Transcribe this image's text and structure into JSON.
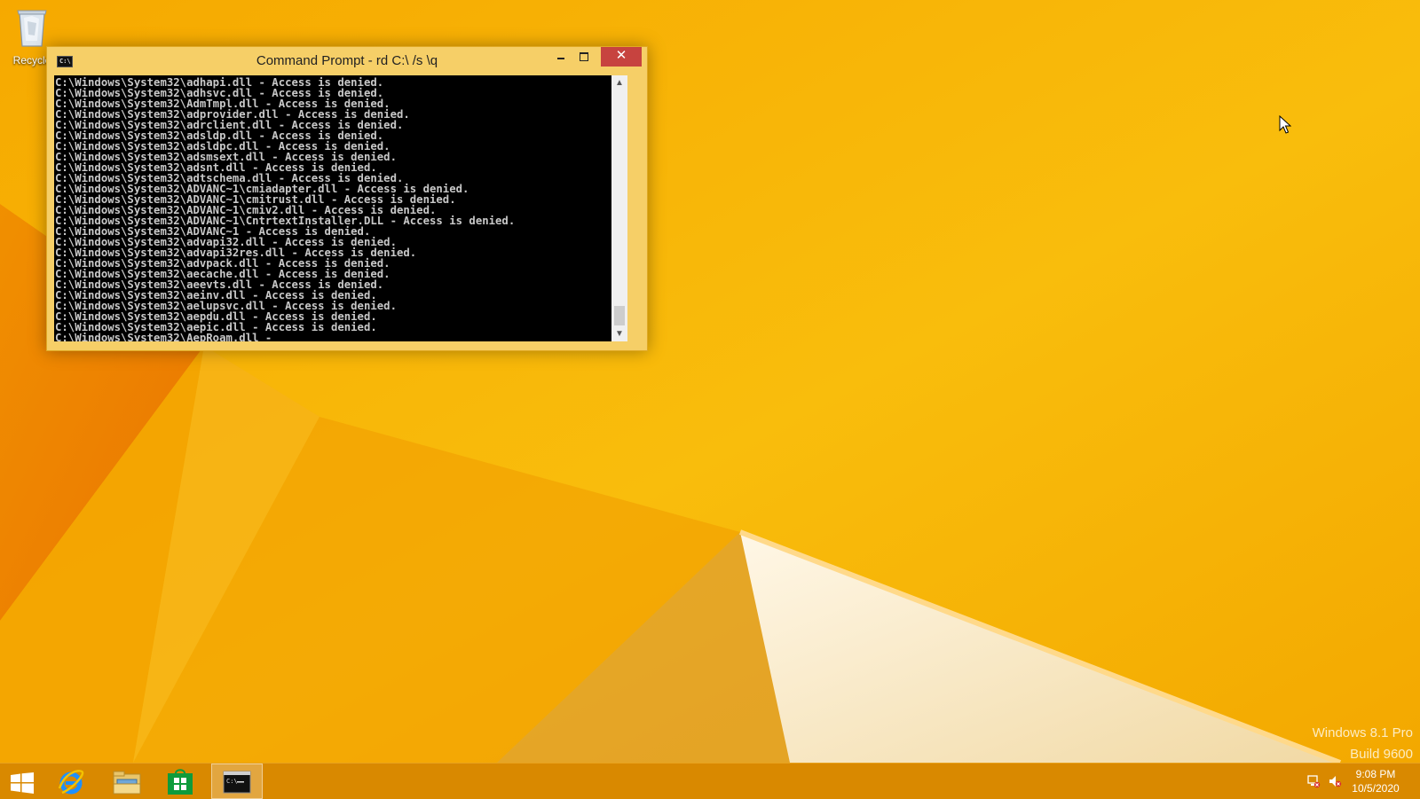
{
  "desktop": {
    "icons": [
      {
        "label": "Recycle",
        "icon": "recycle-bin-icon"
      }
    ],
    "watermark": {
      "edition": "Windows 8.1 Pro",
      "build": "Build 9600"
    },
    "colors": {
      "background": "#f8b400",
      "accent": "#e07a10"
    }
  },
  "window": {
    "title": "Command Prompt - rd  C:\\ /s \\q",
    "icon": "cmd-icon",
    "controls": {
      "minimize": "minimize-icon",
      "maximize": "maximize-icon",
      "close": "close-icon"
    },
    "console_lines": [
      "C:\\Windows\\System32\\adhapi.dll - Access is denied.",
      "C:\\Windows\\System32\\adhsvc.dll - Access is denied.",
      "C:\\Windows\\System32\\AdmTmpl.dll - Access is denied.",
      "C:\\Windows\\System32\\adprovider.dll - Access is denied.",
      "C:\\Windows\\System32\\adrclient.dll - Access is denied.",
      "C:\\Windows\\System32\\adsldp.dll - Access is denied.",
      "C:\\Windows\\System32\\adsldpc.dll - Access is denied.",
      "C:\\Windows\\System32\\adsmsext.dll - Access is denied.",
      "C:\\Windows\\System32\\adsnt.dll - Access is denied.",
      "C:\\Windows\\System32\\adtschema.dll - Access is denied.",
      "C:\\Windows\\System32\\ADVANC~1\\cmiadapter.dll - Access is denied.",
      "C:\\Windows\\System32\\ADVANC~1\\cmitrust.dll - Access is denied.",
      "C:\\Windows\\System32\\ADVANC~1\\cmiv2.dll - Access is denied.",
      "C:\\Windows\\System32\\ADVANC~1\\CntrtextInstaller.DLL - Access is denied.",
      "C:\\Windows\\System32\\ADVANC~1 - Access is denied.",
      "C:\\Windows\\System32\\advapi32.dll - Access is denied.",
      "C:\\Windows\\System32\\advapi32res.dll - Access is denied.",
      "C:\\Windows\\System32\\advpack.dll - Access is denied.",
      "C:\\Windows\\System32\\aecache.dll - Access is denied.",
      "C:\\Windows\\System32\\aeevts.dll - Access is denied.",
      "C:\\Windows\\System32\\aeinv.dll - Access is denied.",
      "C:\\Windows\\System32\\aelupsvc.dll - Access is denied.",
      "C:\\Windows\\System32\\aepdu.dll - Access is denied.",
      "C:\\Windows\\System32\\aepic.dll - Access is denied.",
      "C:\\Windows\\System32\\AepRoam.dll -"
    ],
    "colors": {
      "frame": "#f6cf67",
      "close": "#c7433f",
      "console_bg": "#000000",
      "console_fg": "#c8c8c8"
    }
  },
  "taskbar": {
    "items": [
      {
        "name": "start",
        "icon": "windows-logo-icon"
      },
      {
        "name": "internet-explorer",
        "icon": "internet-explorer-icon"
      },
      {
        "name": "file-explorer",
        "icon": "folder-icon"
      },
      {
        "name": "store",
        "icon": "store-icon"
      },
      {
        "name": "command-prompt",
        "icon": "cmd-icon",
        "active": true
      }
    ],
    "tray": {
      "icons": [
        "network-icon",
        "volume-muted-icon"
      ]
    },
    "clock": {
      "time": "9:08 PM",
      "date": "10/5/2020"
    }
  }
}
